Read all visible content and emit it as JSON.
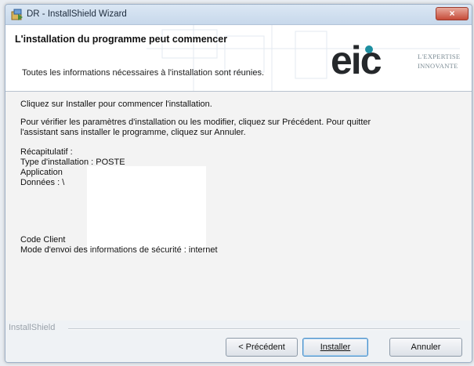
{
  "window": {
    "title": "DR - InstallShield Wizard",
    "close_label": "×"
  },
  "header": {
    "title": "L'installation du programme peut commencer",
    "subtitle": "Toutes les informations nécessaires à l'installation sont réunies.",
    "logo_text": "eic",
    "tagline_line1": "L'EXPERTISE",
    "tagline_line2": "INNOVANTE",
    "logo_color": "#1d8fa1",
    "logo_letter_color": "#25282b"
  },
  "body": {
    "intro": "Cliquez sur Installer pour commencer l'installation.",
    "review_line1": "Pour vérifier les paramètres d'installation ou les modifier, cliquez sur Précédent. Pour quitter",
    "review_line2": "l'assistant sans installer le programme, cliquez sur Annuler.",
    "summary_label": "Récapitulatif :",
    "install_type": "Type d'installation : POSTE",
    "application": "Application",
    "data": "Données : \\",
    "client_code": "Code Client",
    "security_mode": "Mode d'envoi des informations de sécurité : internet"
  },
  "footer": {
    "brand": "InstallShield",
    "back_label": "< Précédent",
    "install_label": "Installer",
    "cancel_label": "Annuler"
  }
}
